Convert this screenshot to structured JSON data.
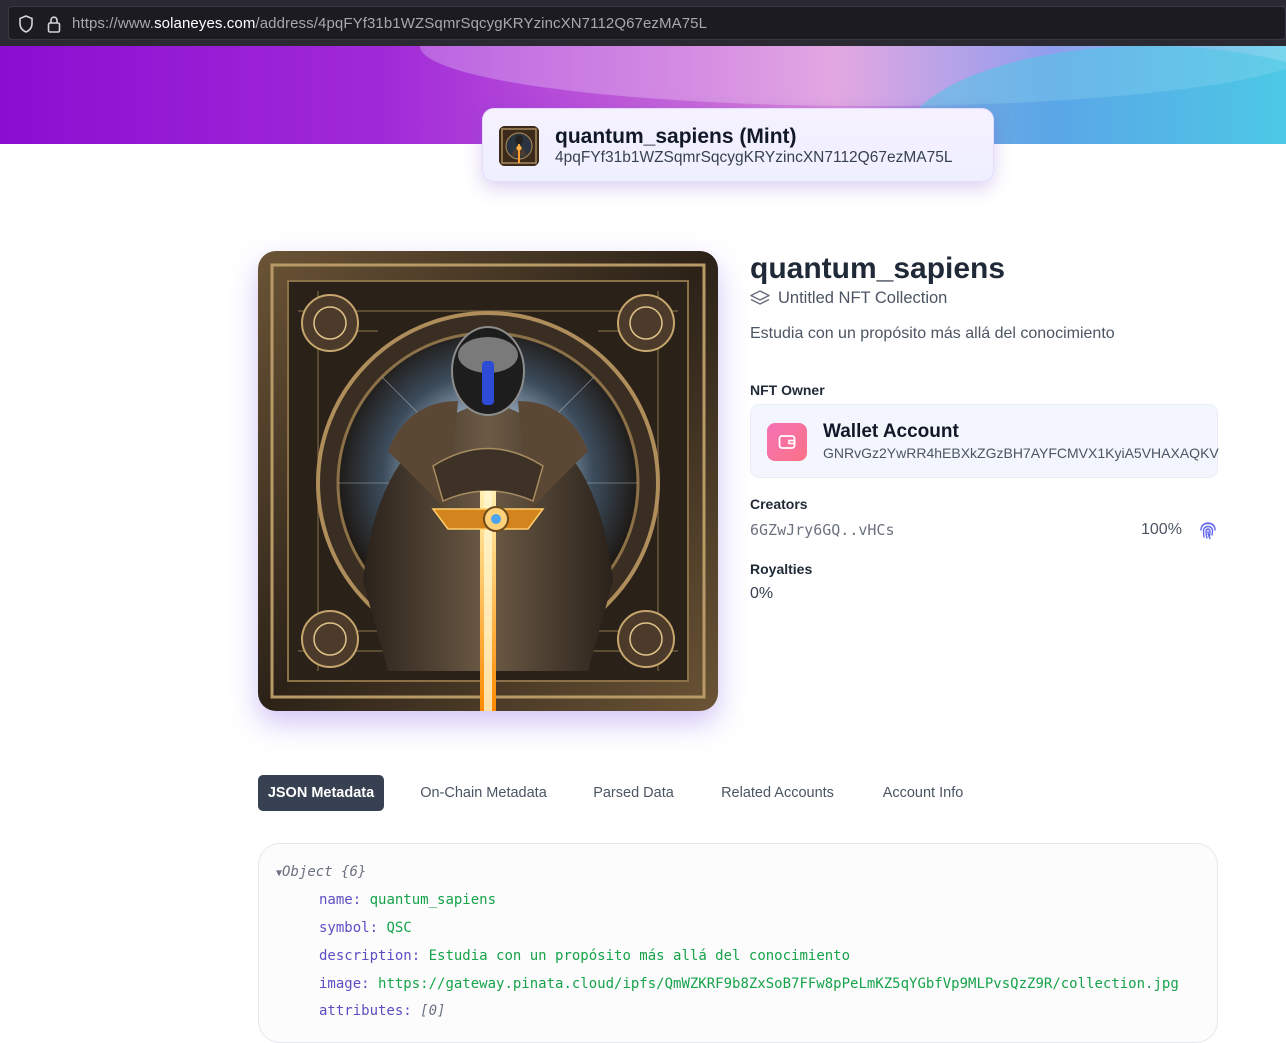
{
  "browser": {
    "url_prefix": "https://www.",
    "url_host": "solaneyes.com",
    "url_path": "/address/4pqFYf31b1WZSqmrSqcygKRYzincXN7112Q67ezMA75L"
  },
  "mint_header": {
    "title": "quantum_sapiens (Mint)",
    "address": "4pqFYf31b1WZSqmrSqcygKRYzincXN7112Q67ezMA75L"
  },
  "nft": {
    "name": "quantum_sapiens",
    "collection": "Untitled NFT Collection",
    "description": "Estudia con un propósito más allá del conocimiento",
    "image_icon": "nft-artwork"
  },
  "owner": {
    "label": "NFT Owner",
    "title": "Wallet Account",
    "address": "GNRvGz2YwRR4hEBXkZGzBH7AYFCMVX1KyiA5VHAXAQKV",
    "icon": "wallet-icon"
  },
  "creators": {
    "label": "Creators",
    "items": [
      {
        "address": "6GZwJry6GQ..vHCs",
        "share": "100%",
        "icon": "fingerprint-icon"
      }
    ]
  },
  "royalties": {
    "label": "Royalties",
    "value": "0%"
  },
  "tabs": [
    {
      "label": "JSON Metadata",
      "active": true
    },
    {
      "label": "On-Chain Metadata",
      "active": false
    },
    {
      "label": "Parsed Data",
      "active": false
    },
    {
      "label": "Related Accounts",
      "active": false
    },
    {
      "label": "Account Info",
      "active": false
    }
  ],
  "json_view": {
    "root": "Object {6}",
    "entries": [
      {
        "key": "name:",
        "value": "quantum_sapiens"
      },
      {
        "key": "symbol:",
        "value": "QSC"
      },
      {
        "key": "description:",
        "value": "Estudia con un propósito más allá del conocimiento"
      },
      {
        "key": "image:",
        "value": "https://gateway.pinata.cloud/ipfs/QmWZKRF9b8ZxSoB7FFw8pPeLmKZ5qYGbfVp9MLPvsQzZ9R/collection.jpg"
      },
      {
        "key": "attributes:",
        "value": "[0]"
      }
    ]
  },
  "colors": {
    "accent": "#374151",
    "json_key": "#5b4ec2",
    "json_string": "#16a34a",
    "wallet_badge": "#f472b6"
  }
}
